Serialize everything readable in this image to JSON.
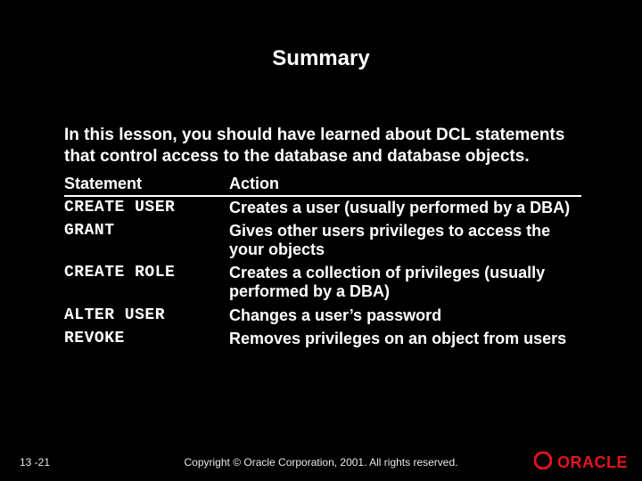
{
  "title": "Summary",
  "lead": "In this lesson, you should have learned about DCL statements that control access to the database and database objects.",
  "table": {
    "headers": [
      "Statement",
      "Action"
    ],
    "rows": [
      {
        "stmt": "CREATE USER",
        "action": "Creates a user (usually performed by a DBA)"
      },
      {
        "stmt": "GRANT",
        "action": "Gives other users privileges to access the your objects"
      },
      {
        "stmt": "CREATE ROLE",
        "action": "Creates a collection of privileges (usually performed by a DBA)"
      },
      {
        "stmt": "ALTER USER",
        "action": "Changes a user’s password"
      },
      {
        "stmt": "REVOKE",
        "action": "Removes privileges on an object from users"
      }
    ]
  },
  "footer": {
    "slide_number": "13 -21",
    "copyright": "Copyright © Oracle Corporation, 2001. All rights reserved.",
    "brand": "ORACLE"
  }
}
